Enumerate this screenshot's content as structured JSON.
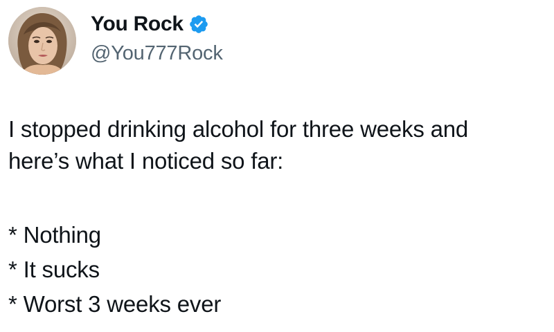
{
  "author": {
    "display_name": "You Rock",
    "handle": "@You777Rock",
    "avatar_icon": "profile-photo",
    "verified_icon": "verified-badge-icon",
    "verified_color": "#1d9bf0"
  },
  "tweet": {
    "line1": "I stopped drinking alcohol for three weeks and",
    "line2": "here’s what I noticed so far:",
    "items": [
      "* Nothing",
      "* It sucks",
      "* Worst 3 weeks ever"
    ]
  },
  "colors": {
    "text": "#0f1419",
    "secondary_text": "#536471",
    "background": "#ffffff"
  }
}
